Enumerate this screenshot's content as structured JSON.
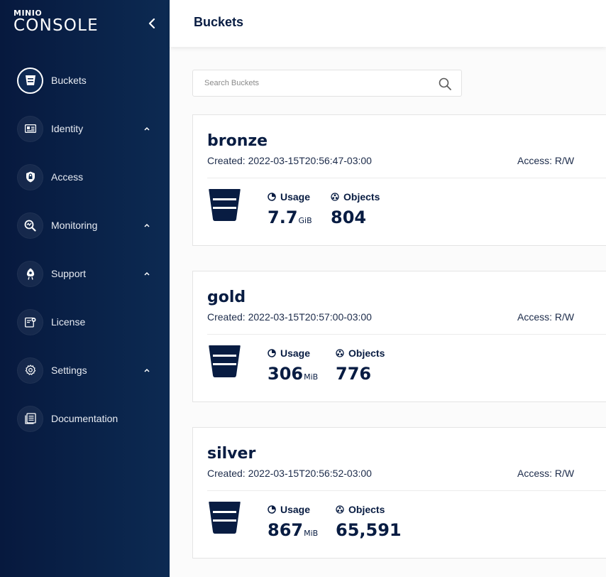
{
  "app": {
    "logo_top": "MINIO",
    "logo_bottom": "CONSOLE"
  },
  "sidebar": {
    "items": [
      {
        "label": "Buckets",
        "icon": "bucket-icon",
        "active": true,
        "chevron": false
      },
      {
        "label": "Identity",
        "icon": "id-card-icon",
        "active": false,
        "chevron": true
      },
      {
        "label": "Access",
        "icon": "shield-lock-icon",
        "active": false,
        "chevron": false
      },
      {
        "label": "Monitoring",
        "icon": "monitoring-icon",
        "active": false,
        "chevron": true
      },
      {
        "label": "Support",
        "icon": "support-icon",
        "active": false,
        "chevron": true
      },
      {
        "label": "License",
        "icon": "license-icon",
        "active": false,
        "chevron": false
      },
      {
        "label": "Settings",
        "icon": "gear-icon",
        "active": false,
        "chevron": true
      },
      {
        "label": "Documentation",
        "icon": "documentation-icon",
        "active": false,
        "chevron": false
      }
    ]
  },
  "header": {
    "title": "Buckets"
  },
  "search": {
    "placeholder": "Search Buckets",
    "value": ""
  },
  "buckets": [
    {
      "name": "bronze",
      "created": "Created: 2022-03-15T20:56:47-03:00",
      "access": "Access: R/W",
      "usage_label": "Usage",
      "usage_value": "7.7",
      "usage_unit": "GiB",
      "objects_label": "Objects",
      "objects_value": "804"
    },
    {
      "name": "gold",
      "created": "Created: 2022-03-15T20:57:00-03:00",
      "access": "Access: R/W",
      "usage_label": "Usage",
      "usage_value": "306",
      "usage_unit": "MiB",
      "objects_label": "Objects",
      "objects_value": "776"
    },
    {
      "name": "silver",
      "created": "Created: 2022-03-15T20:56:52-03:00",
      "access": "Access: R/W",
      "usage_label": "Usage",
      "usage_value": "867",
      "usage_unit": "MiB",
      "objects_label": "Objects",
      "objects_value": "65,591"
    }
  ],
  "colors": {
    "sidebar_start": "#07193e",
    "sidebar_end": "#0c2a52",
    "primary_text": "#081c42",
    "background": "#fbfbfb"
  }
}
